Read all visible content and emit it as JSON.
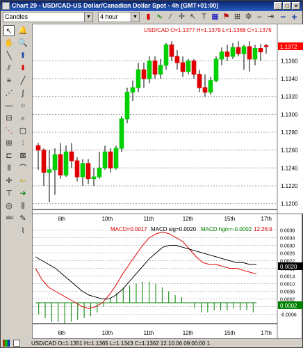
{
  "window": {
    "title": "Chart 29 - USD/CAD-US Dollar/Canadian Dollar Spot - 4h (GMT+01:00)"
  },
  "toolbar": {
    "chart_type": "Candles",
    "interval": "4 hour"
  },
  "price_panel": {
    "ohlc_label": "USD/CAD O=1.1377 H=1.1379 L=1.1368 C=1.1376",
    "current_price": "1.1372",
    "y_ticks": [
      "1.1360",
      "1.1340",
      "1.1320",
      "1.1300",
      "1.1280",
      "1.1260",
      "1.1240",
      "1.1220",
      "1.1200"
    ],
    "x_ticks": [
      "6th",
      "10th",
      "11th",
      "12th",
      "15th",
      "17th"
    ]
  },
  "macd_panel": {
    "macd_label": "MACD=0.0017",
    "sig_label": "MACD sig=0.0020",
    "hgm_label": "MACD hgm=-0.0002",
    "time_label": "12:26:9",
    "current_value": "0.0020",
    "current_hgm": "0.0002",
    "y_ticks": [
      "0.0038",
      "0.0034",
      "0.0030",
      "0.0026",
      "0.0022",
      "0.0018",
      "0.0014",
      "0.0010",
      "0.0006",
      "0.0002",
      "-0.0002",
      "-0.0006"
    ],
    "x_ticks": [
      "6th",
      "10th",
      "11th",
      "12th",
      "15th",
      "17th"
    ]
  },
  "statusbar": {
    "text": "USD/CAD O=1.1351 H=1.1365 L=1.1343 C=1.1362   12.10.06 09:00:00 1."
  },
  "colors": {
    "up": "#00d000",
    "down": "#e00000",
    "macd": "#e00000",
    "signal": "#000000",
    "hist": "#008000",
    "highlight": "#ff0000"
  },
  "chart_data": [
    {
      "type": "candlestick",
      "title": "USD/CAD O=1.1377 H=1.1379 L=1.1368 C=1.1376",
      "x_ticks": [
        "6th",
        "10th",
        "11th",
        "12th",
        "15th",
        "17th"
      ],
      "ylim": [
        1.1195,
        1.139
      ],
      "candles": [
        {
          "o": 1.1265,
          "h": 1.1268,
          "l": 1.1238,
          "c": 1.126
        },
        {
          "o": 1.126,
          "h": 1.1262,
          "l": 1.122,
          "c": 1.1235
        },
        {
          "o": 1.1235,
          "h": 1.126,
          "l": 1.1202,
          "c": 1.1238
        },
        {
          "o": 1.1238,
          "h": 1.1262,
          "l": 1.121,
          "c": 1.1255
        },
        {
          "o": 1.1255,
          "h": 1.1268,
          "l": 1.1228,
          "c": 1.1232
        },
        {
          "o": 1.1232,
          "h": 1.1265,
          "l": 1.123,
          "c": 1.1258
        },
        {
          "o": 1.1258,
          "h": 1.1268,
          "l": 1.124,
          "c": 1.1248
        },
        {
          "o": 1.1248,
          "h": 1.1252,
          "l": 1.1225,
          "c": 1.123
        },
        {
          "o": 1.123,
          "h": 1.125,
          "l": 1.122,
          "c": 1.1245
        },
        {
          "o": 1.1245,
          "h": 1.125,
          "l": 1.1222,
          "c": 1.1228
        },
        {
          "o": 1.1228,
          "h": 1.124,
          "l": 1.122,
          "c": 1.123
        },
        {
          "o": 1.123,
          "h": 1.1258,
          "l": 1.1228,
          "c": 1.124
        },
        {
          "o": 1.124,
          "h": 1.1265,
          "l": 1.1238,
          "c": 1.1258
        },
        {
          "o": 1.1258,
          "h": 1.1262,
          "l": 1.1235,
          "c": 1.124
        },
        {
          "o": 1.124,
          "h": 1.1265,
          "l": 1.1238,
          "c": 1.1262
        },
        {
          "o": 1.1262,
          "h": 1.1298,
          "l": 1.1258,
          "c": 1.1295
        },
        {
          "o": 1.1295,
          "h": 1.133,
          "l": 1.129,
          "c": 1.1325
        },
        {
          "o": 1.1325,
          "h": 1.1338,
          "l": 1.1315,
          "c": 1.133
        },
        {
          "o": 1.133,
          "h": 1.1358,
          "l": 1.1325,
          "c": 1.135
        },
        {
          "o": 1.135,
          "h": 1.1358,
          "l": 1.133,
          "c": 1.134
        },
        {
          "o": 1.134,
          "h": 1.1365,
          "l": 1.1335,
          "c": 1.136
        },
        {
          "o": 1.136,
          "h": 1.1365,
          "l": 1.134,
          "c": 1.1345
        },
        {
          "o": 1.1345,
          "h": 1.1362,
          "l": 1.134,
          "c": 1.1355
        },
        {
          "o": 1.1355,
          "h": 1.138,
          "l": 1.135,
          "c": 1.1378
        },
        {
          "o": 1.1378,
          "h": 1.1382,
          "l": 1.136,
          "c": 1.1365
        },
        {
          "o": 1.1365,
          "h": 1.1372,
          "l": 1.135,
          "c": 1.1358
        },
        {
          "o": 1.1358,
          "h": 1.1365,
          "l": 1.1342,
          "c": 1.1348
        },
        {
          "o": 1.1348,
          "h": 1.1362,
          "l": 1.1345,
          "c": 1.136
        },
        {
          "o": 1.136,
          "h": 1.1362,
          "l": 1.134,
          "c": 1.1345
        },
        {
          "o": 1.1345,
          "h": 1.135,
          "l": 1.1325,
          "c": 1.133
        },
        {
          "o": 1.133,
          "h": 1.1345,
          "l": 1.132,
          "c": 1.1325
        },
        {
          "o": 1.1325,
          "h": 1.1342,
          "l": 1.1322,
          "c": 1.1338
        },
        {
          "o": 1.1338,
          "h": 1.1365,
          "l": 1.1336,
          "c": 1.1362
        },
        {
          "o": 1.1362,
          "h": 1.1375,
          "l": 1.1355,
          "c": 1.137
        },
        {
          "o": 1.137,
          "h": 1.1378,
          "l": 1.136,
          "c": 1.1365
        },
        {
          "o": 1.1365,
          "h": 1.138,
          "l": 1.1362,
          "c": 1.1375
        },
        {
          "o": 1.1375,
          "h": 1.1382,
          "l": 1.1365,
          "c": 1.1368
        },
        {
          "o": 1.1368,
          "h": 1.1378,
          "l": 1.135,
          "c": 1.1376
        },
        {
          "o": 1.1376,
          "h": 1.1382,
          "l": 1.1348,
          "c": 1.1362
        },
        {
          "o": 1.1362,
          "h": 1.1378,
          "l": 1.1355,
          "c": 1.1374
        },
        {
          "o": 1.1374,
          "h": 1.1379,
          "l": 1.136,
          "c": 1.137
        },
        {
          "o": 1.1377,
          "h": 1.1379,
          "l": 1.1368,
          "c": 1.1376
        }
      ]
    },
    {
      "type": "line",
      "title": "MACD",
      "ylim": [
        -0.0008,
        0.004
      ],
      "series": [
        {
          "name": "MACD",
          "values": [
            0.0018,
            0.0012,
            0.0008,
            0.0006,
            0.0004,
            0.0002,
            0.0,
            -0.0002,
            -0.0003,
            -0.0002,
            0.0,
            0.0004,
            0.0009,
            0.0015,
            0.002,
            0.0025,
            0.003,
            0.0034,
            0.0036,
            0.0037,
            0.0036,
            0.0034,
            0.0032,
            0.0028,
            0.0024,
            0.0021,
            0.002,
            0.002,
            0.0019,
            0.0018,
            0.0018,
            0.0017,
            0.0016,
            0.0015
          ]
        },
        {
          "name": "MACD sig",
          "values": [
            0.0024,
            0.0022,
            0.002,
            0.0018,
            0.0015,
            0.0012,
            0.0009,
            0.0006,
            0.0004,
            0.0003,
            0.0002,
            0.0002,
            0.0004,
            0.0007,
            0.0011,
            0.0015,
            0.0019,
            0.0023,
            0.0026,
            0.0029,
            0.003,
            0.003,
            0.0029,
            0.0028,
            0.0027,
            0.0026,
            0.0025,
            0.0024,
            0.0023,
            0.0022,
            0.0021,
            0.0021,
            0.002,
            0.002
          ]
        },
        {
          "name": "MACD hgm",
          "values": [
            -0.0006,
            -0.0008,
            -0.001,
            -0.001,
            -0.0011,
            -0.001,
            -0.0009,
            -0.0008,
            -0.0007,
            -0.0005,
            -0.0002,
            0.0002,
            0.0005,
            0.0008,
            0.0009,
            0.001,
            0.0011,
            0.0011,
            0.001,
            0.0008,
            0.0006,
            0.0004,
            0.0003,
            0.0,
            -0.0003,
            -0.0005,
            -0.0005,
            -0.0004,
            -0.0004,
            -0.0004,
            -0.0003,
            -0.0004,
            -0.0004,
            -0.0005
          ]
        }
      ]
    }
  ]
}
